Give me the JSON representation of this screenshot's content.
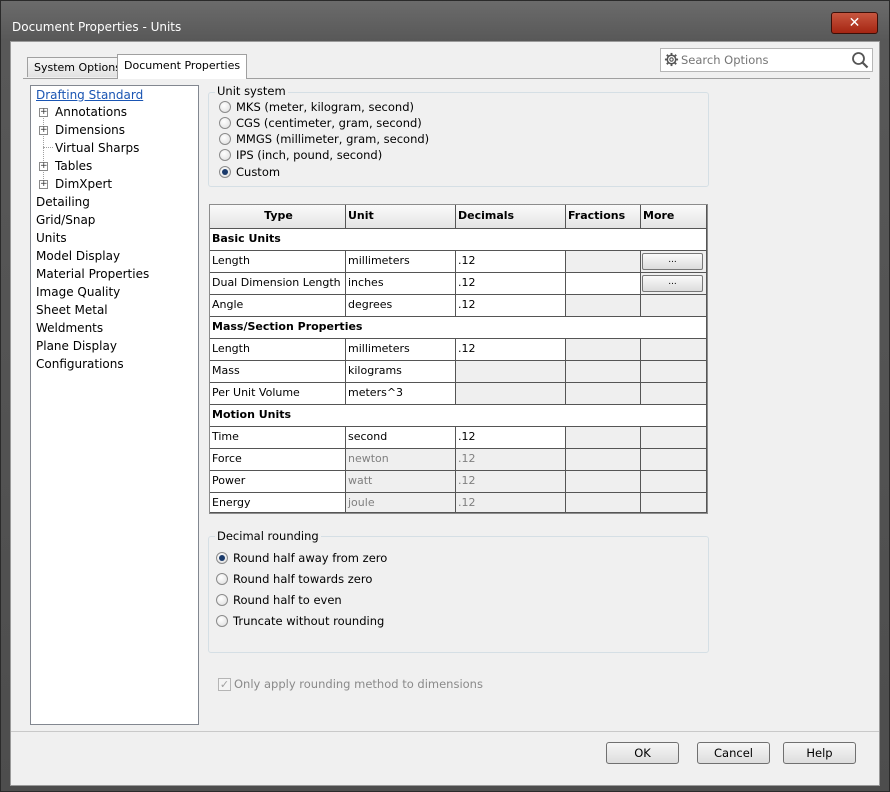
{
  "window": {
    "title": "Document Properties - Units",
    "close_label": "✕"
  },
  "tabs": [
    {
      "label": "System Options"
    },
    {
      "label": "Document Properties"
    }
  ],
  "search": {
    "placeholder": "Search Options"
  },
  "tree": {
    "items": [
      {
        "label": "Drafting Standard"
      },
      {
        "label": "Annotations"
      },
      {
        "label": "Dimensions"
      },
      {
        "label": "Virtual Sharps"
      },
      {
        "label": "Tables"
      },
      {
        "label": "DimXpert"
      },
      {
        "label": "Detailing"
      },
      {
        "label": "Grid/Snap"
      },
      {
        "label": "Units"
      },
      {
        "label": "Model Display"
      },
      {
        "label": "Material Properties"
      },
      {
        "label": "Image Quality"
      },
      {
        "label": "Sheet Metal"
      },
      {
        "label": "Weldments"
      },
      {
        "label": "Plane Display"
      },
      {
        "label": "Configurations"
      }
    ]
  },
  "unit_system": {
    "title": "Unit system",
    "options": [
      {
        "label": "MKS  (meter, kilogram, second)"
      },
      {
        "label": "CGS  (centimeter, gram, second)"
      },
      {
        "label": "MMGS (millimeter, gram, second)"
      },
      {
        "label": "IPS  (inch, pound, second)"
      },
      {
        "label": "Custom"
      }
    ],
    "selected": "Custom"
  },
  "table": {
    "headers": [
      "Type",
      "Unit",
      "Decimals",
      "Fractions",
      "More"
    ],
    "sections": [
      {
        "title": "Basic Units",
        "rows": [
          {
            "type": "Length",
            "unit": "millimeters",
            "decimals": ".12",
            "fractions": "",
            "more": "..."
          },
          {
            "type": "Dual Dimension Length",
            "unit": "inches",
            "decimals": ".12",
            "fractions": "",
            "more": "..."
          },
          {
            "type": "Angle",
            "unit": "degrees",
            "decimals": ".12",
            "fractions": "",
            "more": ""
          }
        ]
      },
      {
        "title": "Mass/Section Properties",
        "rows": [
          {
            "type": "Length",
            "unit": "millimeters",
            "decimals": ".12",
            "fractions": "",
            "more": ""
          },
          {
            "type": "Mass",
            "unit": "kilograms",
            "decimals": "",
            "fractions": "",
            "more": ""
          },
          {
            "type": "Per Unit Volume",
            "unit": "meters^3",
            "decimals": "",
            "fractions": "",
            "more": ""
          }
        ]
      },
      {
        "title": "Motion Units",
        "rows": [
          {
            "type": "Time",
            "unit": "second",
            "decimals": ".12",
            "fractions": "",
            "more": ""
          },
          {
            "type": "Force",
            "unit": "newton",
            "decimals": ".12",
            "fractions": "",
            "more": ""
          },
          {
            "type": "Power",
            "unit": "watt",
            "decimals": ".12",
            "fractions": "",
            "more": ""
          },
          {
            "type": "Energy",
            "unit": "joule",
            "decimals": ".12",
            "fractions": "",
            "more": ""
          }
        ]
      }
    ]
  },
  "decimal_rounding": {
    "title": "Decimal rounding",
    "options": [
      {
        "label": "Round half away from zero"
      },
      {
        "label": "Round half towards zero"
      },
      {
        "label": "Round half to even"
      },
      {
        "label": "Truncate without rounding"
      }
    ],
    "selected": "Round half away from zero"
  },
  "only_apply": {
    "label": "Only apply rounding method to dimensions",
    "checked": true,
    "enabled": false
  },
  "buttons": {
    "ok": "OK",
    "cancel": "Cancel",
    "help": "Help"
  }
}
